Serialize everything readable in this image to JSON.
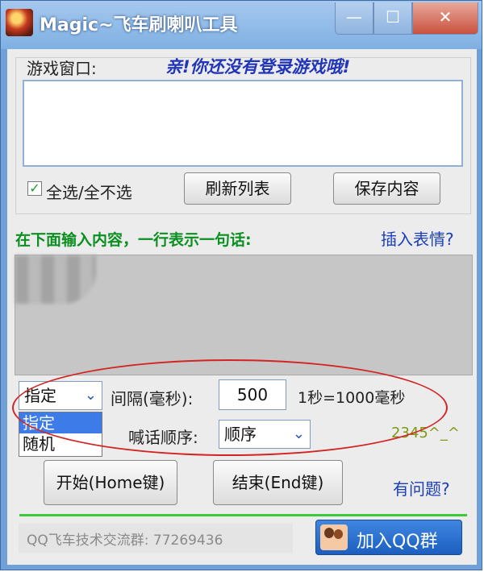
{
  "window": {
    "title": "Magic~飞车刷喇叭工具",
    "controls": {
      "minimize": "—",
      "maximize": "☐",
      "close": "✕"
    }
  },
  "game_window": {
    "label": "游戏窗口:",
    "status_message": "亲!你还没有登录游戏哦!",
    "select_all_checked": true,
    "select_all_label": "全选/全不选",
    "refresh_button": "刷新列表",
    "save_button": "保存内容"
  },
  "content": {
    "instruction": "在下面输入内容，一行表示一句话:",
    "insert_emoji_link": "插入表情?"
  },
  "settings": {
    "mode_select": {
      "selected": "指定",
      "options": [
        "指定",
        "随机"
      ]
    },
    "interval_label": "间隔(毫秒):",
    "interval_value": "500",
    "interval_hint": "1秒=1000毫秒",
    "order_label": "喊话顺序:",
    "order_value": "顺序",
    "smiley": "2345^_^"
  },
  "actions": {
    "start_button": "开始(Home键)",
    "end_button": "结束(End键)",
    "help_link": "有问题?"
  },
  "footer": {
    "qq_group_text": "QQ飞车技术交流群: 77269436",
    "join_qq_button": "加入QQ群"
  },
  "colors": {
    "titlebar": "#8fb8e8",
    "status_message": "#2135b8",
    "instruction": "#0a8f20",
    "link": "#1b3fb8",
    "highlight_ellipse": "#d32424",
    "progress": "#3ec83e",
    "selected_option": "#3d7be8"
  }
}
